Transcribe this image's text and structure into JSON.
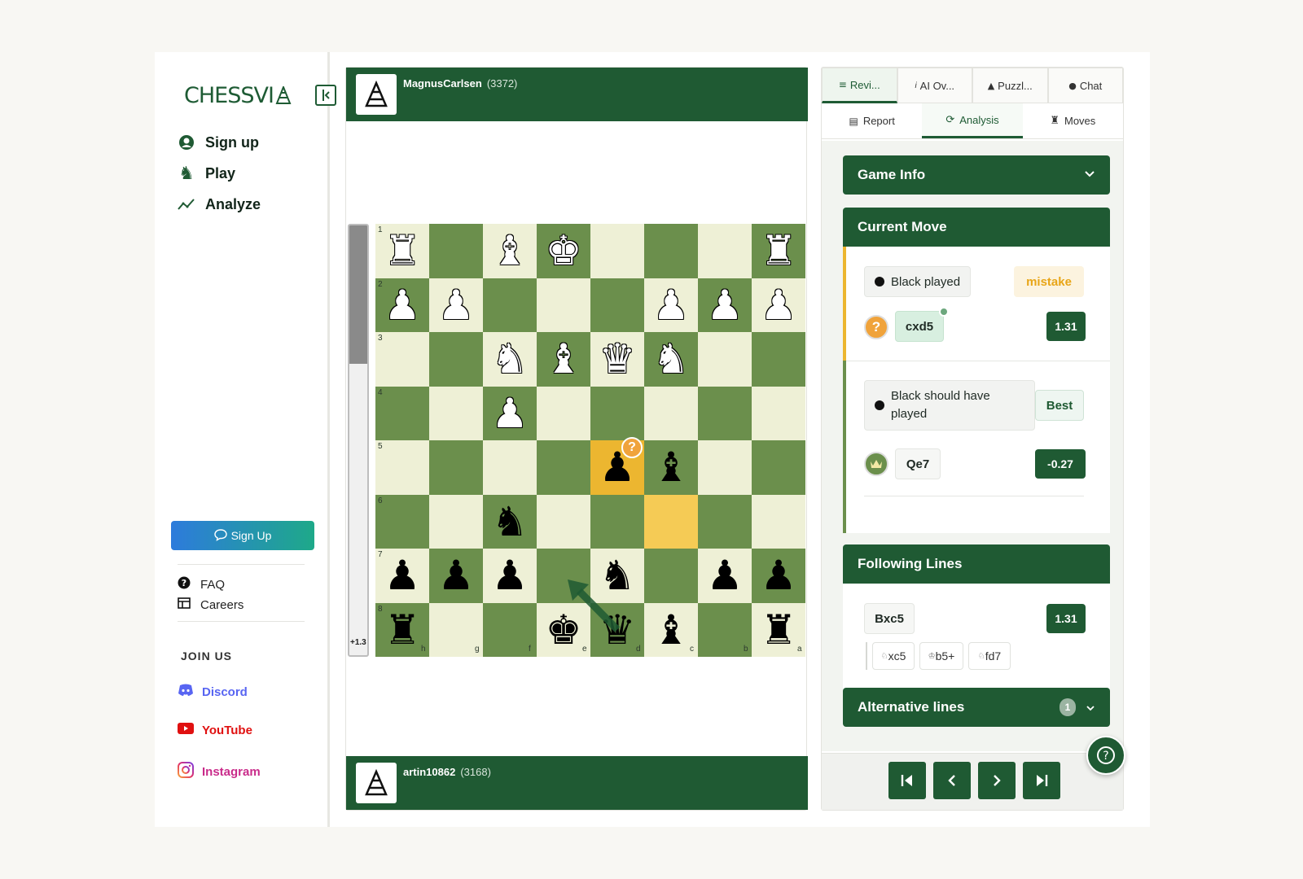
{
  "brand": {
    "name": "CHESSVI",
    "logo_suffix": "A"
  },
  "nav": {
    "signup": "Sign up",
    "play": "Play",
    "analyze": "Analyze"
  },
  "sidebar": {
    "signup_button": "Sign Up",
    "faq": "FAQ",
    "careers": "Careers",
    "join_us": "JOIN US",
    "discord": "Discord",
    "youtube": "YouTube",
    "instagram": "Instagram"
  },
  "colors": {
    "brand_green": "#1f5a33",
    "light_square": "#eef0d6",
    "dark_square": "#6b8f4c",
    "highlight": "#ecb630",
    "mistake": "#e8a517",
    "discord": "#5865f2",
    "youtube": "#e01010",
    "instagram": "#c92b8a"
  },
  "players": {
    "top": {
      "name": "MagnusCarlsen",
      "rating": "(3372)"
    },
    "bottom": {
      "name": "artin10862",
      "rating": "(3168)"
    }
  },
  "eval_bar": {
    "label": "+1.3"
  },
  "board": {
    "ranks": [
      "1",
      "2",
      "3",
      "4",
      "5",
      "6",
      "7",
      "8"
    ],
    "files": [
      "h",
      "g",
      "f",
      "e",
      "d",
      "c",
      "b",
      "a"
    ],
    "rows": [
      [
        "wR",
        "",
        "wB",
        "wK",
        "",
        "",
        "",
        "wR"
      ],
      [
        "wP",
        "wP",
        "",
        "",
        "",
        "wP",
        "wP",
        "wP"
      ],
      [
        "",
        "",
        "wN",
        "wB",
        "wQ",
        "wN",
        "",
        ""
      ],
      [
        "",
        "",
        "wP",
        "",
        "",
        "",
        "",
        ""
      ],
      [
        "",
        "",
        "",
        "",
        "bP",
        "bB",
        "",
        ""
      ],
      [
        "",
        "",
        "bN",
        "",
        "",
        "",
        "",
        ""
      ],
      [
        "bP",
        "bP",
        "bP",
        "",
        "bN",
        "",
        "bP",
        "bP"
      ],
      [
        "bR",
        "",
        "",
        "bK",
        "bQ",
        "bB",
        "",
        "bR"
      ]
    ],
    "highlight_squares": [
      [
        4,
        4
      ],
      [
        5,
        5
      ]
    ],
    "mistake_square": [
      4,
      4
    ]
  },
  "tabs_top": [
    {
      "label": "Revi...",
      "icon": "list-icon",
      "active": true
    },
    {
      "label": "AI Ov...",
      "icon": "info-icon",
      "active": false
    },
    {
      "label": "Puzzl...",
      "icon": "warning-icon",
      "active": false
    },
    {
      "label": "Chat",
      "icon": "chat-icon",
      "active": false
    }
  ],
  "tabs_sub": [
    {
      "label": "Report",
      "icon": "report-icon",
      "active": false
    },
    {
      "label": "Analysis",
      "icon": "analysis-icon",
      "active": true
    },
    {
      "label": "Moves",
      "icon": "rook-icon",
      "active": false
    }
  ],
  "game_info": {
    "title": "Game Info"
  },
  "current_move": {
    "title": "Current Move",
    "played_label": "Black played",
    "classification": "mistake",
    "move": "cxd5",
    "score": "1.31",
    "should_have_label": "Black should have played",
    "best_label": "Best",
    "best_move": "Qe7",
    "best_score": "-0.27"
  },
  "following_lines": {
    "title": "Following Lines",
    "main_move": "Bxc5",
    "score": "1.31",
    "continuation": [
      "xc5",
      "b5+",
      "fd7"
    ]
  },
  "alternative_lines": {
    "title": "Alternative lines",
    "count": "1"
  }
}
